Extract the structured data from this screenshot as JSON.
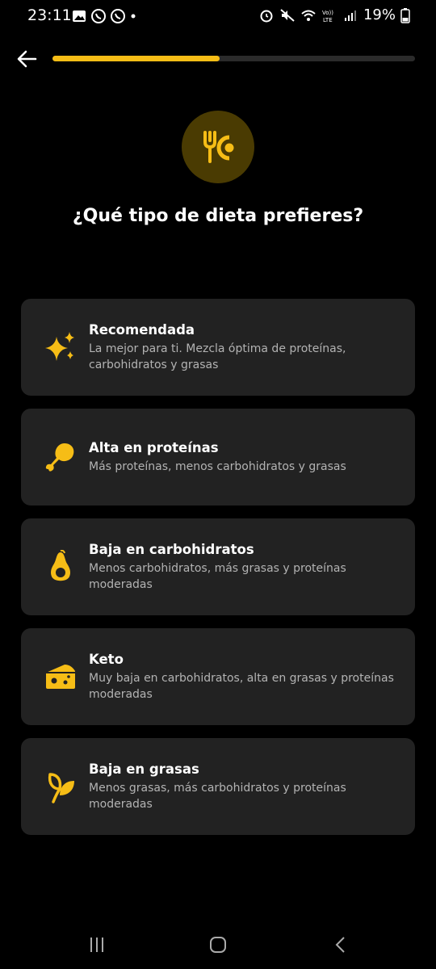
{
  "status_bar": {
    "time": "23:11",
    "battery": "19%"
  },
  "progress": {
    "fraction": 0.46
  },
  "header": {
    "title": "¿Qué tipo de dieta prefieres?"
  },
  "accent_color": "#f6bd16",
  "options": [
    {
      "icon": "sparkles-icon",
      "title": "Recomendada",
      "description": "La mejor para ti. Mezcla óptima de proteínas, carbohidratos y grasas"
    },
    {
      "icon": "chicken-leg-icon",
      "title": "Alta en proteínas",
      "description": "Más proteínas, menos carbohidratos y grasas"
    },
    {
      "icon": "avocado-icon",
      "title": "Baja en carbohidratos",
      "description": "Menos carbohidratos, más grasas y proteínas moderadas"
    },
    {
      "icon": "cheese-icon",
      "title": "Keto",
      "description": "Muy baja en carbohidratos, alta en grasas y proteínas moderadas"
    },
    {
      "icon": "leaf-icon",
      "title": "Baja en grasas",
      "description": "Menos grasas, más carbohidratos y proteínas moderadas"
    }
  ]
}
